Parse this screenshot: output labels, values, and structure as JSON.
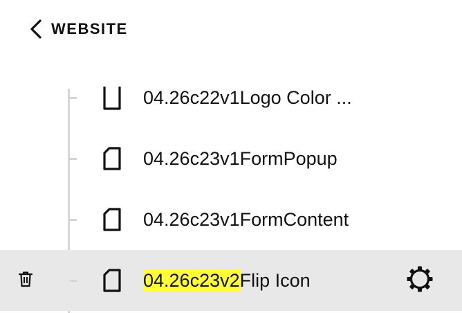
{
  "header": {
    "back_label": "WEBSITE"
  },
  "pages": [
    {
      "label": "04.26c22v1Logo Color ..."
    },
    {
      "label": "04.26c23v1FormPopup"
    },
    {
      "label": "04.26c23v1FormContent"
    },
    {
      "highlight": "04.26c23v2",
      "rest": "Flip Icon",
      "selected": true
    }
  ],
  "icons": {
    "back": "chevron-left-icon",
    "page": "page-icon",
    "trash": "trash-icon",
    "settings": "gear-icon"
  },
  "colors": {
    "selected_row": "#e8e8e8",
    "search_highlight": "#ffff33",
    "tree_line": "#d6d6d6"
  }
}
